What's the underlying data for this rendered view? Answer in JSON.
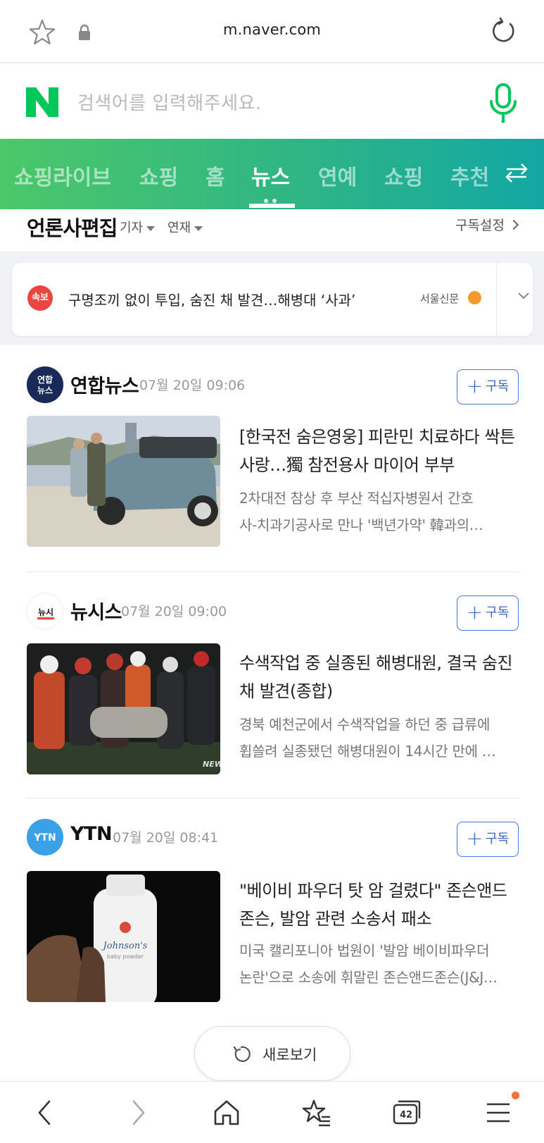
{
  "browser": {
    "url": "m.naver.com",
    "tab_count": "42"
  },
  "search": {
    "placeholder": "검색어를 입력해주세요."
  },
  "nav": {
    "tabs": [
      "쇼핑라이브",
      "쇼핑",
      "홈",
      "뉴스",
      "연예",
      "쇼핑",
      "추천"
    ],
    "active": "뉴스"
  },
  "section": {
    "title": "언론사편집",
    "filter_reporter": "기자",
    "filter_series": "연재",
    "subscription_settings": "구독설정"
  },
  "breaking": {
    "badge": "속보",
    "headline": "구명조끼 없이 투입, 숨진 채 발견…해병대 ‘사과’",
    "press": "서울신문"
  },
  "articles": [
    {
      "press": "연합뉴스",
      "logo_text": "연합\n뉴스",
      "time": "07월 20일 09:06",
      "subscribe_label": "구독",
      "title": "[한국전 숨은영웅] 피란민 치료하다 싹튼 사랑…獨 참전용사 마이어 부부",
      "summary_line1": "2차대전 참상 후 부산 적십자병원서 간호",
      "summary_line2": "사-치과기공사로 만나 '백년가약' 韓과의…"
    },
    {
      "press": "뉴시스",
      "logo_text": "NEWSIS",
      "time": "07월 20일 09:00",
      "subscribe_label": "구독",
      "title": "수색작업 중 실종된 해병대원, 결국 숨진 채 발견(종합)",
      "summary_line1": "경북 예천군에서 수색작업을 하던 중 급류에",
      "summary_line2": "휩쓸려 실종됐던 해병대원이 14시간 만에 …"
    },
    {
      "press": "YTN",
      "logo_text": "YTN",
      "time": "07월 20일 08:41",
      "subscribe_label": "구독",
      "title": "\"베이비 파우더 탓 암 걸렸다\" 존슨앤드존슨, 발암 관련 소송서 패소",
      "summary_line1": "미국 캘리포니아 법원이 '발암 베이비파우더",
      "summary_line2": "논란'으로 소송에 휘말린 존슨앤드존슨(J&J…"
    }
  ],
  "refresh_label": "새로보기",
  "colors": {
    "naver_green": "#03c75a",
    "subscribe_blue": "#3e66c8",
    "breaking_red": "#e8463e"
  }
}
